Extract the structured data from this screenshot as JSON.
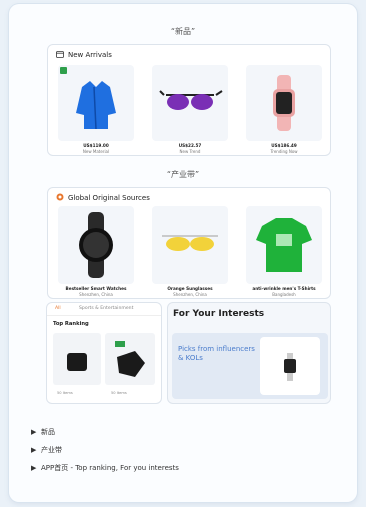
{
  "sections": {
    "new_title": "“新品”",
    "industry_title": "“产业带”"
  },
  "new_arrivals": {
    "header": "New Arrivals",
    "items": [
      {
        "price": "US$119.00",
        "sub": "New Material"
      },
      {
        "price": "US$22.57",
        "sub": "New Trend"
      },
      {
        "price": "US$186.49",
        "sub": "Trending Now"
      }
    ]
  },
  "global_sources": {
    "header": "Global Original Sources",
    "items": [
      {
        "title": "Bestseller Smart Watches",
        "sub": "Shenzhen, China"
      },
      {
        "title": "Orange Sunglasses",
        "sub": "Shenzhen, China"
      },
      {
        "title": "anti-wrinkle men's T-Shirts",
        "sub": "Bangladesh"
      }
    ]
  },
  "ranking_card": {
    "tab_all": "All",
    "tab_sports": "Sports & Entertainment",
    "title": "Top Ranking",
    "captions": [
      "50 Items",
      "50 Items"
    ]
  },
  "interests_card": {
    "title": "For Your Interests",
    "body": "Picks from influencers & KOLs"
  },
  "bullets": [
    "新品",
    "产业带",
    "APP首页 - Top ranking, For you interests"
  ],
  "colors": {
    "accent_blue": "#3b7bd8",
    "tag_green": "#2e9f4b",
    "orange": "#e8772e"
  }
}
